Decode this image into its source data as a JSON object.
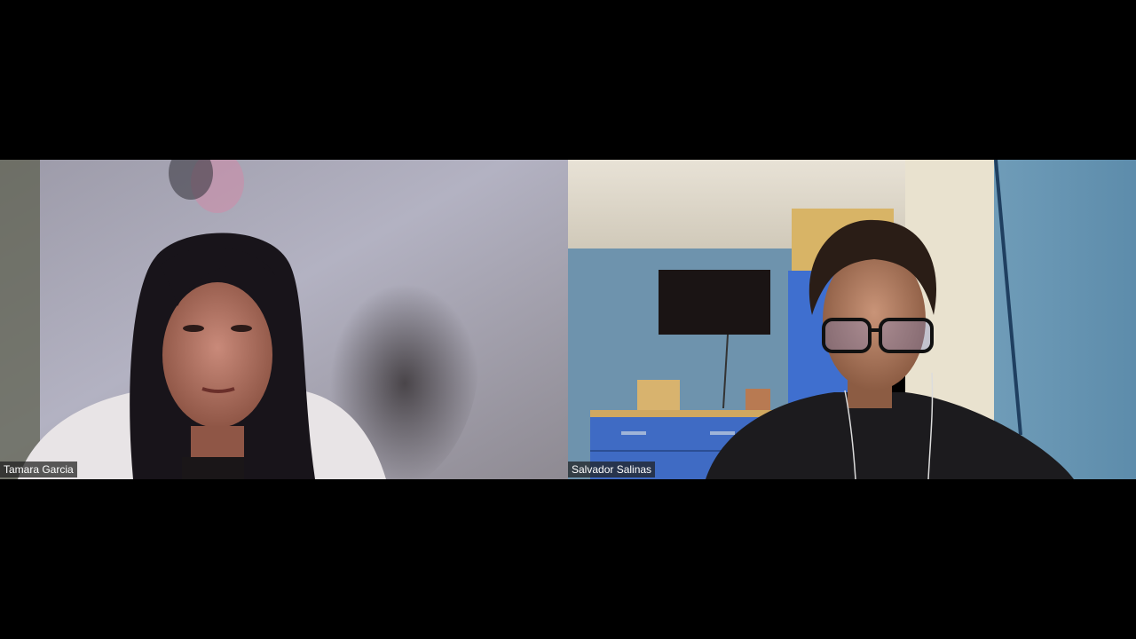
{
  "participants": [
    {
      "name": "Tamara Garcia"
    },
    {
      "name": "Salvador Salinas"
    }
  ]
}
